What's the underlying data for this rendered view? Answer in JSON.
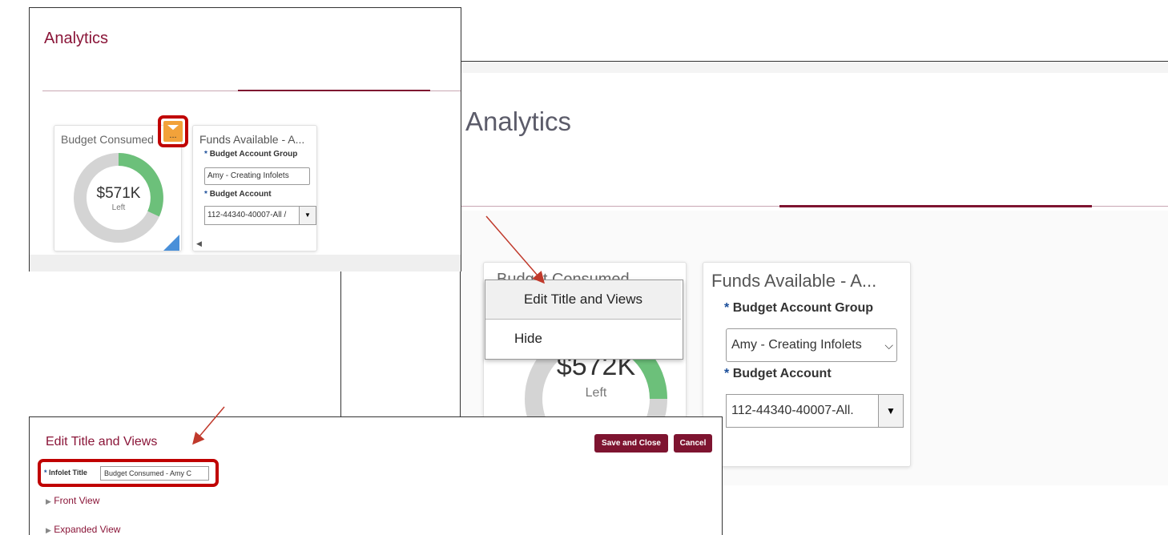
{
  "top_left": {
    "heading": "Analytics",
    "infolet1": {
      "title": "Budget Consumed",
      "amount": "$571K",
      "sub": "Left",
      "menu_dots": "..."
    },
    "infolet2": {
      "title": "Funds Available - A...",
      "group_label": "Budget Account Group",
      "group_value": "Amy - Creating Infolets",
      "account_label": "Budget Account",
      "account_value": "112-44340-40007-All /"
    }
  },
  "right": {
    "heading": "Analytics",
    "menu": {
      "items": [
        "Edit Title and Views",
        "Hide"
      ]
    },
    "infolet1": {
      "title_partial": "Budget Consumed",
      "amount": "$572K",
      "sub": "Left"
    },
    "infolet2": {
      "title": "Funds Available - A...",
      "group_label": "Budget Account Group",
      "group_value": "Amy - Creating Infolets",
      "account_label": "Budget Account",
      "account_value": "112-44340-40007-All."
    }
  },
  "dialog": {
    "title": "Edit Title and Views",
    "save_label": "Save and Close",
    "cancel_label": "Cancel",
    "field_label": "Infolet Title",
    "field_value": "Budget Consumed - Amy C",
    "sections": [
      "Front View",
      "Expanded View"
    ]
  },
  "colors": {
    "accent": "#8a1538",
    "button": "#7e1430",
    "highlight": "#c00000",
    "donut_fill": "#6cc07a",
    "donut_track": "#d4d4d4",
    "arrow": "#c0392b"
  },
  "required_mark": "*"
}
